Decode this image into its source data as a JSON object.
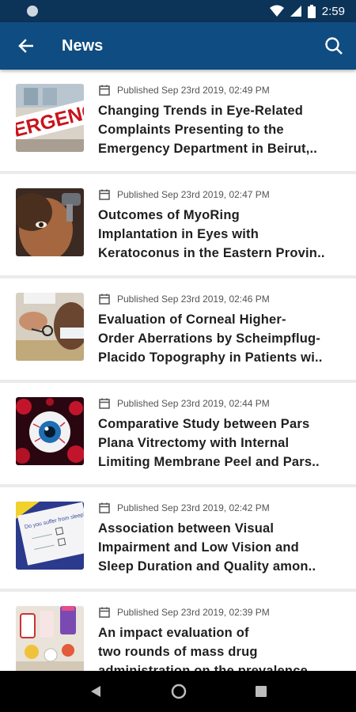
{
  "status": {
    "time": "2:59"
  },
  "header": {
    "title": "News"
  },
  "articles": [
    {
      "published": "Published Sep 23rd 2019, 02:49 PM",
      "title_lines": [
        "Changing Trends in Eye-Related",
        "Complaints Presenting to the",
        "Emergency Department in Beirut,.."
      ]
    },
    {
      "published": "Published Sep 23rd 2019, 02:47 PM",
      "title_lines": [
        "Outcomes of MyoRing",
        "Implantation in Eyes with",
        "Keratoconus in the Eastern Provin.."
      ]
    },
    {
      "published": "Published Sep 23rd 2019, 02:46 PM",
      "title_lines": [
        "Evaluation of Corneal Higher-",
        "Order Aberrations by Scheimpflug-",
        "Placido Topography in Patients wi.."
      ]
    },
    {
      "published": "Published Sep 23rd 2019, 02:44 PM",
      "title_lines": [
        "Comparative Study between Pars",
        "Plana Vitrectomy with Internal",
        "Limiting Membrane Peel and Pars.."
      ]
    },
    {
      "published": "Published Sep 23rd 2019, 02:42 PM",
      "title_lines": [
        "Association between Visual",
        "Impairment and Low Vision and",
        "Sleep Duration and Quality amon.."
      ]
    },
    {
      "published": "Published Sep 23rd 2019, 02:39 PM",
      "title_lines": [
        "An impact evaluation of",
        "two rounds of mass drug",
        "administration on the prevalence"
      ]
    }
  ],
  "thumbnails": {
    "emergency_sign_text": "ERGENC",
    "questionnaire_text": "Do you suffer from sleeping disorder?"
  },
  "colors": {
    "app_bar": "#0f4c81",
    "status_bar": "#0c3358",
    "background": "#ebebeb"
  },
  "icons": [
    "back-arrow-icon",
    "search-icon",
    "calendar-icon",
    "wifi-icon",
    "signal-icon",
    "battery-icon",
    "nav-back-icon",
    "nav-home-icon",
    "nav-recents-icon"
  ]
}
